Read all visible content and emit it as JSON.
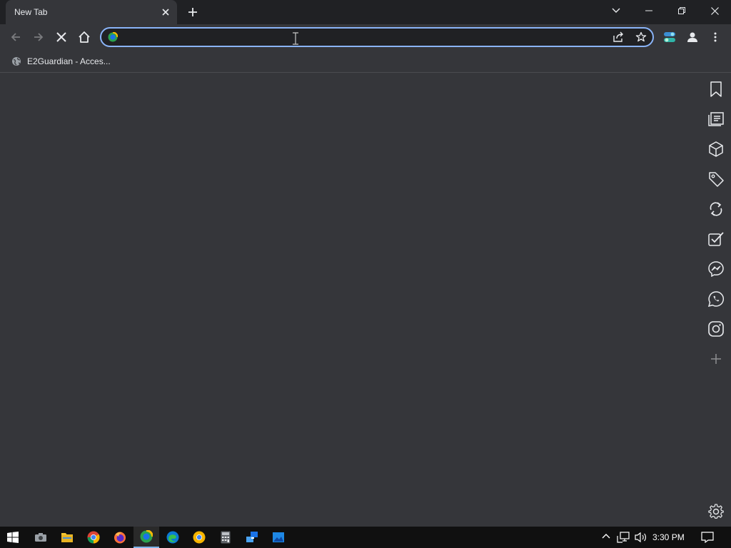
{
  "tab": {
    "title": "New Tab"
  },
  "omnibox": {
    "value": "",
    "placeholder": ""
  },
  "bookmarks": [
    {
      "label": "E2Guardian - Acces..."
    }
  ],
  "taskbar": {
    "time": "3:30 PM"
  },
  "colors": {
    "accent": "#8ab4f8",
    "background": "#35363a",
    "titlebar": "#202124",
    "taskbar": "#101010"
  },
  "sidebar_icons": [
    "bookmark-icon",
    "reading-list-icon",
    "box-icon",
    "tag-icon",
    "sync-icon",
    "checklist-icon",
    "messenger-icon",
    "whatsapp-icon",
    "instagram-icon",
    "add-icon",
    "settings-icon"
  ]
}
